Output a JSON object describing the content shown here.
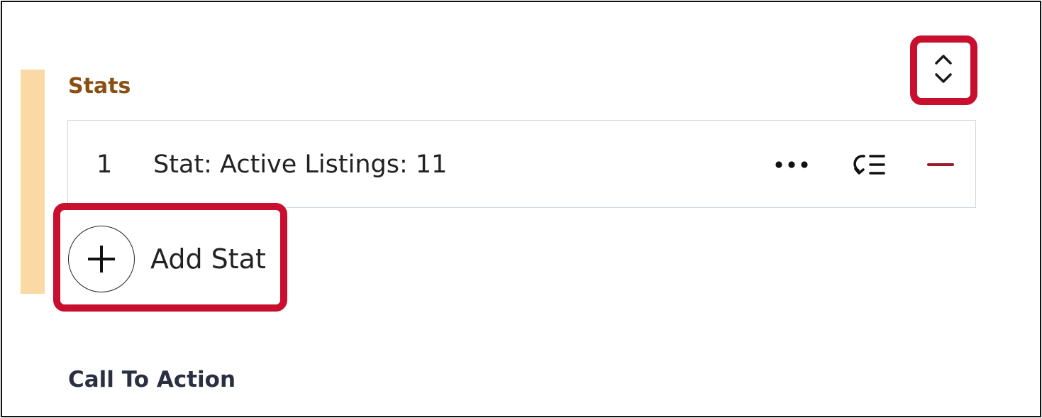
{
  "stats_section": {
    "title": "Stats",
    "accent_color": "#fbd9a4",
    "title_color": "#8a4f12",
    "collapse_toggle_icon": "chevron-up-down-icon",
    "items": [
      {
        "index": "1",
        "label": "Stat: Active Listings: 11",
        "actions": [
          "more-options-icon",
          "replace-list-icon",
          "remove-icon"
        ]
      }
    ],
    "add_label": "Add Stat",
    "add_icon": "plus-circle-icon"
  },
  "next_section": {
    "title": "Call To Action"
  },
  "highlight_color": "#c8102e",
  "remove_color": "#a31626"
}
